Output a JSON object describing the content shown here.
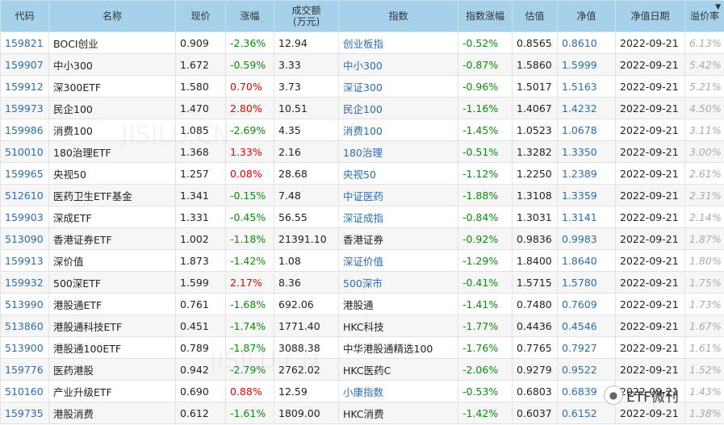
{
  "headers": [
    "代码",
    "名称",
    "现价",
    "涨幅",
    "成交额",
    "(万元)",
    "指数",
    "指数涨幅",
    "估值",
    "净值",
    "净值日期",
    "溢价率"
  ],
  "sort_indicator": "▼",
  "rows": [
    {
      "code": "159821",
      "name": "BOCI创业",
      "price": "0.909",
      "change": "-2.36%",
      "turnover": "12.94",
      "index": "创业板指",
      "index_link": true,
      "index_change": "-0.52%",
      "est": "0.8565",
      "nav": "0.8610",
      "date": "2022-09-21",
      "premium": "6.13%"
    },
    {
      "code": "159907",
      "name": "中小300",
      "price": "1.672",
      "change": "-0.59%",
      "turnover": "3.33",
      "index": "中小300",
      "index_link": true,
      "index_change": "-0.87%",
      "est": "1.5860",
      "nav": "1.5999",
      "date": "2022-09-21",
      "premium": "5.42%"
    },
    {
      "code": "159912",
      "name": "深300ETF",
      "price": "1.580",
      "change": "0.70%",
      "turnover": "3.73",
      "index": "深证300",
      "index_link": true,
      "index_change": "-0.96%",
      "est": "1.5017",
      "nav": "1.5163",
      "date": "2022-09-21",
      "premium": "5.21%"
    },
    {
      "code": "159973",
      "name": "民企100",
      "price": "1.470",
      "change": "2.80%",
      "turnover": "10.51",
      "index": "民企100",
      "index_link": true,
      "index_change": "-1.16%",
      "est": "1.4067",
      "nav": "1.4232",
      "date": "2022-09-21",
      "premium": "4.50%"
    },
    {
      "code": "159986",
      "name": "消费100",
      "price": "1.085",
      "change": "-2.69%",
      "turnover": "4.35",
      "index": "消费100",
      "index_link": true,
      "index_change": "-1.45%",
      "est": "1.0523",
      "nav": "1.0678",
      "date": "2022-09-21",
      "premium": "3.11%"
    },
    {
      "code": "510010",
      "name": "180治理ETF",
      "price": "1.368",
      "change": "1.33%",
      "turnover": "2.16",
      "index": "180治理",
      "index_link": true,
      "index_change": "-0.51%",
      "est": "1.3282",
      "nav": "1.3350",
      "date": "2022-09-21",
      "premium": "3.00%"
    },
    {
      "code": "159965",
      "name": "央视50",
      "price": "1.257",
      "change": "0.08%",
      "turnover": "28.68",
      "index": "央视50",
      "index_link": true,
      "index_change": "-1.12%",
      "est": "1.2250",
      "nav": "1.2389",
      "date": "2022-09-21",
      "premium": "2.61%"
    },
    {
      "code": "512610",
      "name": "医药卫生ETF基金",
      "price": "1.341",
      "change": "-0.15%",
      "turnover": "7.48",
      "index": "中证医药",
      "index_link": true,
      "index_change": "-1.88%",
      "est": "1.3108",
      "nav": "1.3359",
      "date": "2022-09-21",
      "premium": "2.31%"
    },
    {
      "code": "159903",
      "name": "深成ETF",
      "price": "1.331",
      "change": "-0.45%",
      "turnover": "56.55",
      "index": "深证成指",
      "index_link": true,
      "index_change": "-0.84%",
      "est": "1.3031",
      "nav": "1.3141",
      "date": "2022-09-21",
      "premium": "2.14%"
    },
    {
      "code": "513090",
      "name": "香港证券ETF",
      "price": "1.002",
      "change": "-1.18%",
      "turnover": "21391.10",
      "index": "香港证券",
      "index_link": false,
      "index_change": "-0.92%",
      "est": "0.9836",
      "nav": "0.9983",
      "date": "2022-09-21",
      "premium": "1.87%"
    },
    {
      "code": "159913",
      "name": "深价值",
      "price": "1.873",
      "change": "-1.42%",
      "turnover": "1.08",
      "index": "深证价值",
      "index_link": true,
      "index_change": "-1.29%",
      "est": "1.8400",
      "nav": "1.8640",
      "date": "2022-09-21",
      "premium": "1.80%"
    },
    {
      "code": "159932",
      "name": "500深ETF",
      "price": "1.599",
      "change": "2.17%",
      "turnover": "8.36",
      "index": "500深市",
      "index_link": true,
      "index_change": "-0.41%",
      "est": "1.5715",
      "nav": "1.5780",
      "date": "2022-09-21",
      "premium": "1.75%"
    },
    {
      "code": "513990",
      "name": "港股通ETF",
      "price": "0.761",
      "change": "-1.68%",
      "turnover": "692.06",
      "index": "港股通",
      "index_link": false,
      "index_change": "-1.41%",
      "est": "0.7480",
      "nav": "0.7609",
      "date": "2022-09-21",
      "premium": "1.73%"
    },
    {
      "code": "513860",
      "name": "港股通科技ETF",
      "price": "0.451",
      "change": "-1.74%",
      "turnover": "1771.40",
      "index": "HKC科技",
      "index_link": false,
      "index_change": "-1.77%",
      "est": "0.4436",
      "nav": "0.4546",
      "date": "2022-09-21",
      "premium": "1.67%"
    },
    {
      "code": "513900",
      "name": "港股通100ETF",
      "price": "0.789",
      "change": "-1.87%",
      "turnover": "3088.38",
      "index": "中华港股通精选100",
      "index_link": false,
      "index_change": "-1.76%",
      "est": "0.7765",
      "nav": "0.7927",
      "date": "2022-09-21",
      "premium": "1.61%"
    },
    {
      "code": "159776",
      "name": "医药港股",
      "price": "0.942",
      "change": "-2.79%",
      "turnover": "2762.02",
      "index": "HKC医药C",
      "index_link": false,
      "index_change": "-2.06%",
      "est": "0.9279",
      "nav": "0.9522",
      "date": "2022-09-21",
      "premium": "1.52%"
    },
    {
      "code": "510160",
      "name": "产业升级ETF",
      "price": "0.690",
      "change": "0.88%",
      "turnover": "12.59",
      "index": "小康指数",
      "index_link": true,
      "index_change": "-0.53%",
      "est": "0.6803",
      "nav": "0.6839",
      "date": "2022-09-21",
      "premium": "1.43%"
    },
    {
      "code": "159735",
      "name": "港股消费",
      "price": "0.612",
      "change": "-1.61%",
      "turnover": "1809.00",
      "index": "HKC消费",
      "index_link": false,
      "index_change": "-1.42%",
      "est": "0.6037",
      "nav": "0.6152",
      "date": "2022-09-21",
      "premium": "1.38%"
    }
  ],
  "watermark_text": "JISILU.CN",
  "badge": {
    "icon": "wechat-icon",
    "label": "ETF微刊"
  }
}
